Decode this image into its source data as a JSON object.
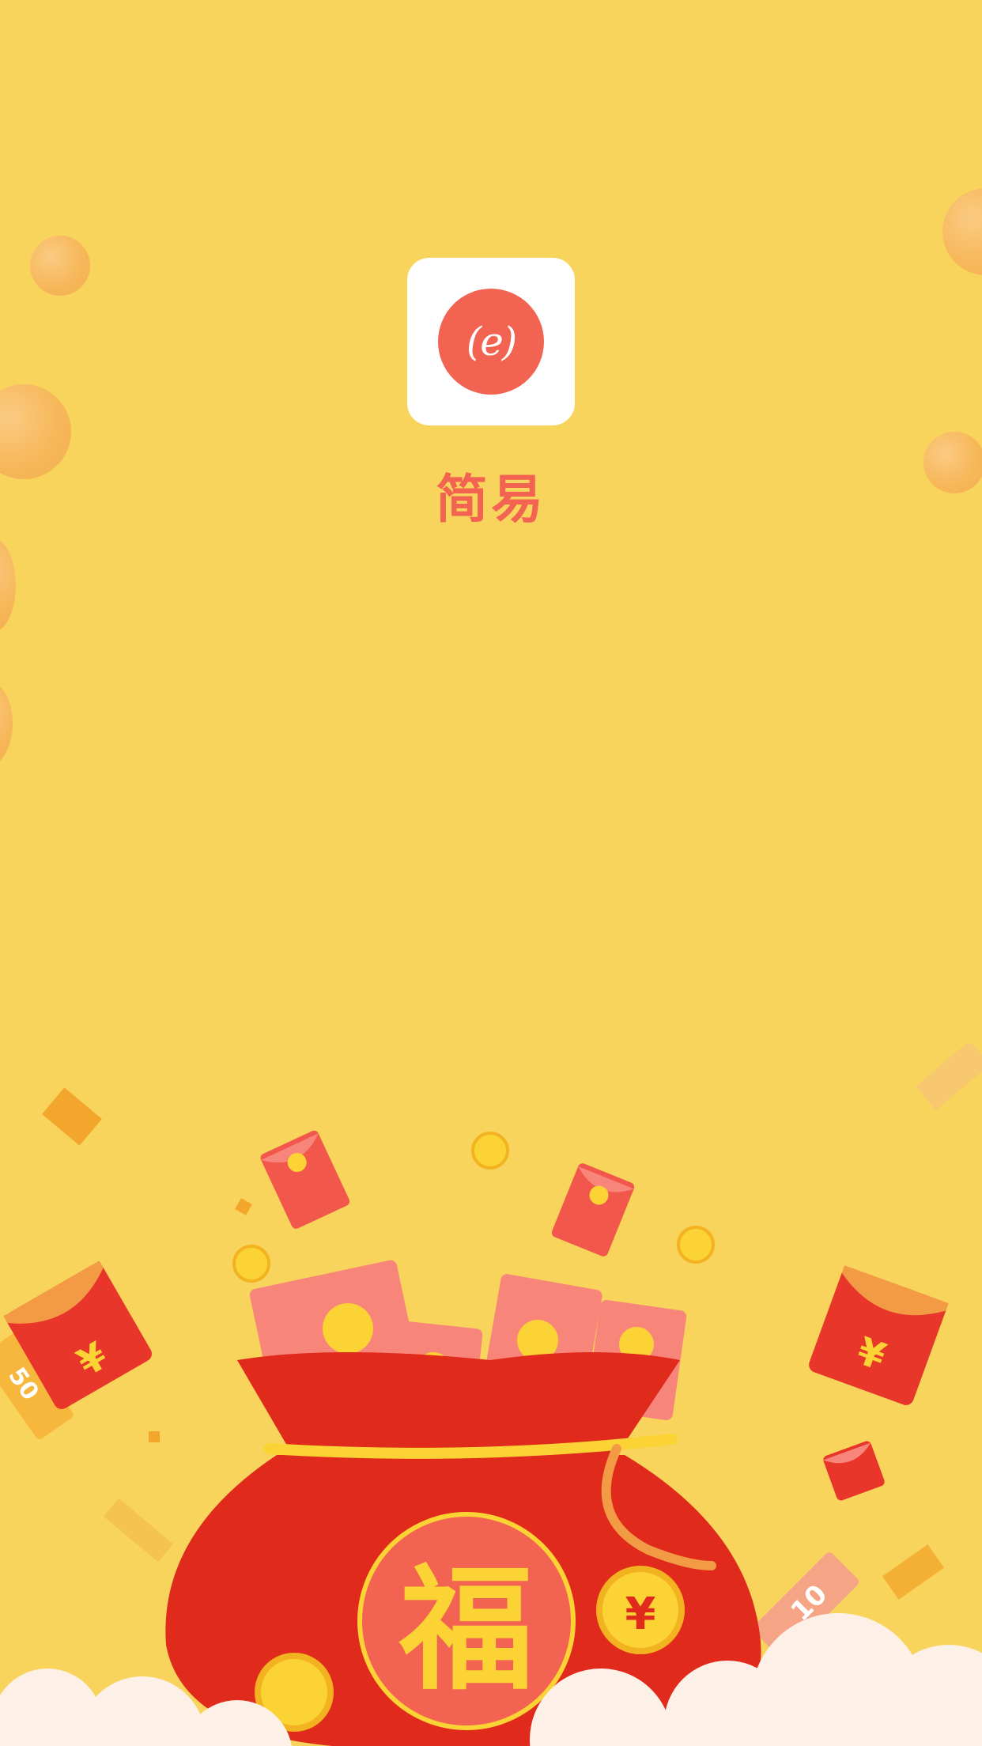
{
  "app": {
    "name": "简易",
    "logo_glyph": "(e)",
    "logo_icon": "e-logo-icon"
  },
  "illustration": {
    "bag_character": "福",
    "coin_symbol": "¥",
    "coupon_value": "10",
    "coupon_left_value": "50"
  },
  "colors": {
    "background": "#f8d45c",
    "accent": "#f26351",
    "bag_red": "#e02a1c",
    "coin_gold": "#fbd335"
  }
}
